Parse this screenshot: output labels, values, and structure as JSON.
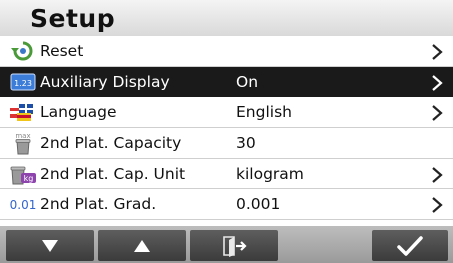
{
  "header": {
    "title": "Setup"
  },
  "menu": {
    "items": [
      {
        "label": "Reset",
        "value": "",
        "icon": "reset-icon",
        "has_arrow": true
      },
      {
        "label": "Auxiliary Display",
        "value": "On",
        "icon": "auxiliary-display-icon",
        "has_arrow": true
      },
      {
        "label": "Language",
        "value": "English",
        "icon": "language-flags-icon",
        "has_arrow": true
      },
      {
        "label": "2nd Plat. Capacity",
        "value": "30",
        "icon": "max-capacity-icon",
        "has_arrow": false
      },
      {
        "label": "2nd Plat. Cap. Unit",
        "value": "kilogram",
        "icon": "unit-kg-icon",
        "has_arrow": true
      },
      {
        "label": "2nd Plat. Grad.",
        "value": "0.001",
        "icon": "graduation-icon",
        "has_arrow": true
      }
    ]
  },
  "icons": {
    "auxiliary_display_text": "1.23",
    "max_text": "max",
    "kg_text": "kg",
    "graduation_text": "0.01"
  },
  "footer": {
    "buttons": [
      "down-arrow-icon",
      "up-arrow-icon",
      "exit-icon",
      "checkmark-icon"
    ]
  },
  "colors": {
    "selected_row": "#1a1a1a",
    "button": "#4a4a4a",
    "icon_blue": "#3366cc"
  }
}
